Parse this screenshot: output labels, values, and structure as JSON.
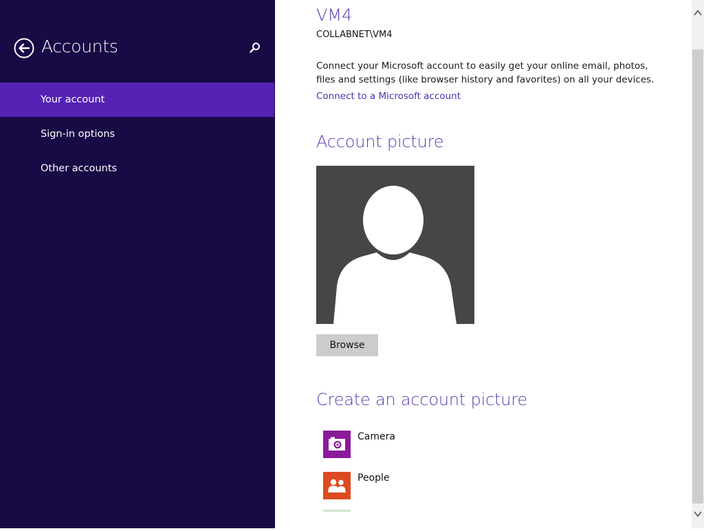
{
  "sidebar": {
    "title": "Accounts",
    "back_icon": "back-arrow-icon",
    "search_icon": "search-icon",
    "items": [
      {
        "label": "Your account",
        "active": true
      },
      {
        "label": "Sign-in options",
        "active": false
      },
      {
        "label": "Other accounts",
        "active": false
      }
    ]
  },
  "user": {
    "name": "VM4",
    "domain": "COLLABNET\\VM4"
  },
  "connect": {
    "description": "Connect your Microsoft account to easily get your online email, photos, files and settings (like browser history and favorites) on all your devices.",
    "link": "Connect to a Microsoft account"
  },
  "account_picture": {
    "heading": "Account picture",
    "browse_label": "Browse"
  },
  "create_picture": {
    "heading": "Create an account picture",
    "apps": [
      {
        "label": "Camera",
        "icon": "camera-icon",
        "color": "#8b1a9a"
      },
      {
        "label": "People",
        "icon": "people-icon",
        "color": "#dc4a20"
      }
    ]
  },
  "colors": {
    "sidebar_bg": "#180a45",
    "active_item": "#5522b5",
    "accent": "#5a3ab0"
  }
}
